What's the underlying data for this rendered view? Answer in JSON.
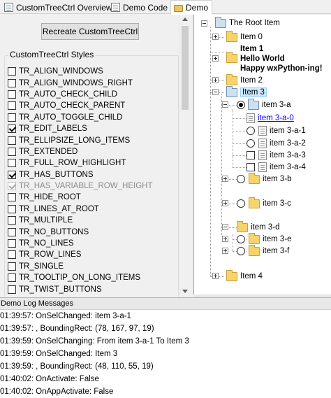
{
  "tabs": [
    {
      "label": "CustomTreeCtrl Overview",
      "icon": "doc-icon"
    },
    {
      "label": "Demo Code",
      "icon": "doc-icon"
    },
    {
      "label": "Demo",
      "icon": "folder-icon",
      "selected": true
    }
  ],
  "left": {
    "recreate_button": "Recreate CustomTreeCtrl",
    "styles_title": "CustomTreeCtrl Styles",
    "styles": [
      {
        "label": "TR_ALIGN_WINDOWS",
        "checked": false,
        "enabled": true
      },
      {
        "label": "TR_ALIGN_WINDOWS_RIGHT",
        "checked": false,
        "enabled": true
      },
      {
        "label": "TR_AUTO_CHECK_CHILD",
        "checked": false,
        "enabled": true
      },
      {
        "label": "TR_AUTO_CHECK_PARENT",
        "checked": false,
        "enabled": true
      },
      {
        "label": "TR_AUTO_TOGGLE_CHILD",
        "checked": false,
        "enabled": true
      },
      {
        "label": "TR_EDIT_LABELS",
        "checked": true,
        "enabled": true
      },
      {
        "label": "TR_ELLIPSIZE_LONG_ITEMS",
        "checked": false,
        "enabled": true
      },
      {
        "label": "TR_EXTENDED",
        "checked": false,
        "enabled": true
      },
      {
        "label": "TR_FULL_ROW_HIGHLIGHT",
        "checked": false,
        "enabled": true
      },
      {
        "label": "TR_HAS_BUTTONS",
        "checked": true,
        "enabled": true
      },
      {
        "label": "TR_HAS_VARIABLE_ROW_HEIGHT",
        "checked": true,
        "enabled": false
      },
      {
        "label": "TR_HIDE_ROOT",
        "checked": false,
        "enabled": true
      },
      {
        "label": "TR_LINES_AT_ROOT",
        "checked": false,
        "enabled": true
      },
      {
        "label": "TR_MULTIPLE",
        "checked": false,
        "enabled": true
      },
      {
        "label": "TR_NO_BUTTONS",
        "checked": false,
        "enabled": true
      },
      {
        "label": "TR_NO_LINES",
        "checked": false,
        "enabled": true
      },
      {
        "label": "TR_ROW_LINES",
        "checked": false,
        "enabled": true
      },
      {
        "label": "TR_SINGLE",
        "checked": false,
        "enabled": true
      },
      {
        "label": "TR_TOOLTIP_ON_LONG_ITEMS",
        "checked": false,
        "enabled": true
      },
      {
        "label": "TR_TWIST_BUTTONS",
        "checked": false,
        "enabled": true
      }
    ]
  },
  "tree": {
    "root": "The Root Item",
    "item0": "Item 0",
    "item1_lines": [
      "Item 1",
      "Hello World",
      "Happy wxPython-ing!"
    ],
    "item2": "Item 2",
    "item3": "Item 3",
    "item3a": "item 3-a",
    "item3a0": "item 3-a-0",
    "item3a1": "item 3-a-1",
    "item3a2": "item 3-a-2",
    "item3a3": "item 3-a-3",
    "item3a4": "item 3-a-4",
    "item3b": "item 3-b",
    "item3c": "item 3-c",
    "item3d": "item 3-d",
    "item3e": "item 3-e",
    "item3f": "item 3-f",
    "item4": "Item 4"
  },
  "log": {
    "title": "Demo Log Messages",
    "lines": [
      "01:39:57: OnSelChanged: item 3-a-1",
      "01:39:57: , BoundingRect: (78, 167, 97, 19)",
      "01:39:59: OnSelChanging: From item 3-a-1 To Item 3",
      "01:39:59: OnSelChanged: Item 3",
      "01:39:59: , BoundingRect: (48, 110, 55, 19)",
      "01:40:02: OnActivate: False",
      "01:40:02: OnAppActivate: False"
    ]
  }
}
